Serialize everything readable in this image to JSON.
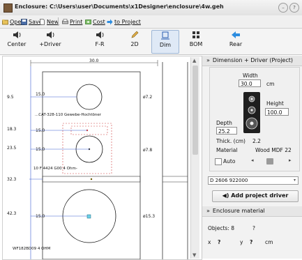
{
  "window": {
    "title": "Enclosure: C:\\Users\\user\\Documents\\x1Designer\\enclosure\\4w.geh",
    "help_glyph": "?"
  },
  "menubar": {
    "items": [
      {
        "label": "Open",
        "icon": "open-icon"
      },
      {
        "label": "Save",
        "icon": "save-icon"
      },
      {
        "label": "New",
        "icon": "new-icon"
      },
      {
        "label": "Print",
        "icon": "print-icon"
      },
      {
        "label": "Cost",
        "icon": "cost-icon"
      },
      {
        "label": "to Project",
        "icon": "arrow-right-icon"
      }
    ]
  },
  "toolbar": {
    "buttons": [
      {
        "label": "Center",
        "icon": "speaker-icon"
      },
      {
        "label": "+Driver",
        "icon": "speaker-icon"
      },
      {
        "label": "F-R",
        "icon": "speaker-icon"
      },
      {
        "label": "2D",
        "icon": "pencil-icon"
      },
      {
        "label": "Dim",
        "icon": "dimension-icon",
        "active": true
      },
      {
        "label": "BOM",
        "icon": "grid-icon"
      },
      {
        "label": "Rear",
        "icon": "arrow-left-icon"
      }
    ]
  },
  "drawing": {
    "width_label": "30.0",
    "annotations": {
      "d1_offset": "9.5",
      "d1_width": "15.0",
      "d1_dia": "ø7.2",
      "d1_name": "...CAT-328-110 Gewebe-Hochtöner",
      "d2_offset": "18.3",
      "d2_width": "15.0",
      "d3_offset": "23.5",
      "d3_width": "15.0",
      "d3_dia": "ø7.8",
      "d3_name": "10 F 4424 G00 4 Ohm-",
      "port_offset": "32.3",
      "d4_offset": "42.3",
      "d4_width": "15.0",
      "d4_dia": "ø15.3",
      "d4_name": "WF182BD09 4 OHM"
    }
  },
  "panel": {
    "header": "Dimension + Driver (Project)",
    "width_label": "Width",
    "width_value": "30.0",
    "unit": "cm",
    "height_label": "Height",
    "height_value": "100.0",
    "depth_label": "Depth",
    "depth_value": "25.2",
    "thick_label": "Thick. (cm)",
    "thick_value": "2.2",
    "material_label": "Material",
    "material_value": "Wood MDF 22",
    "auto_label": "Auto",
    "auto_checked": false,
    "driver_select": "D 2606 922000",
    "add_button": "Add project driver",
    "material_header": "Enclosure material",
    "objects_label": "Objects: 8",
    "objects_help": "?",
    "x_label": "x",
    "x_value": "?",
    "y_label": "y",
    "y_value": "?",
    "xy_unit": "cm"
  }
}
